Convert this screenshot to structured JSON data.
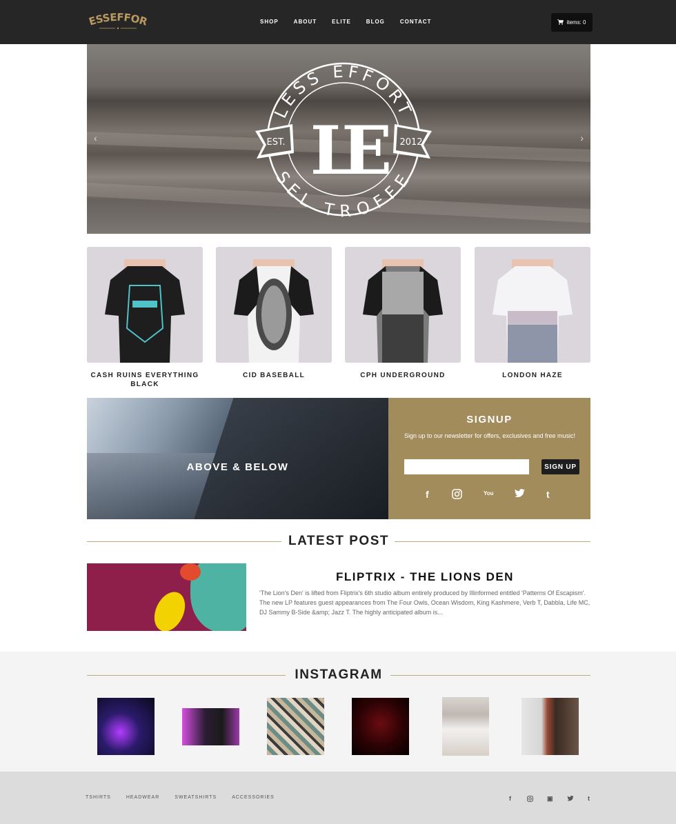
{
  "header": {
    "logo_text": "LESSEFFORT",
    "nav": [
      "SHOP",
      "ABOUT",
      "ELITE",
      "BLOG",
      "CONTACT"
    ],
    "cart_label": "items: 0"
  },
  "hero": {
    "emblem_top_text": "LESS EFFORT",
    "emblem_bottom_text": "SEL TROFFE",
    "emblem_monogram": "LE",
    "emblem_left_ribbon": "EST.",
    "emblem_right_ribbon": "2012",
    "prev_arrow": "‹",
    "next_arrow": "›"
  },
  "products": [
    {
      "name": "CASH RUINS EVERYTHING BLACK"
    },
    {
      "name": "CID BASEBALL"
    },
    {
      "name": "CPH UNDERGROUND"
    },
    {
      "name": "LONDON HAZE"
    }
  ],
  "promo": {
    "title": "ABOVE & BELOW"
  },
  "signup": {
    "title": "SIGNUP",
    "text": "Sign up to our newsletter for offers, exclusives and free music!",
    "input_value": "",
    "button_label": "SIGN UP",
    "socials": [
      "f",
      "◎",
      "You",
      "🐦",
      "t"
    ]
  },
  "latest_post": {
    "heading": "LATEST POST",
    "title": "FLIPTRIX - THE LIONS DEN",
    "excerpt": "'The Lion's Den' is lifted from Fliptrix's 6th studio album entirely produced by Illinformed entitled 'Patterns Of Escapism'. The new LP features guest appearances from The Four Owls, Ocean Wisdom, King Kashmere, Verb T, Dabbla, Life MC, DJ Sammy B-Side &amp; Jazz T. The highly anticipated album is..."
  },
  "instagram": {
    "heading": "INSTAGRAM"
  },
  "footer": {
    "links": [
      "TSHIRTS",
      "HEADWEAR",
      "SWEATSHIRTS",
      "ACCESSORIES"
    ],
    "socials": [
      "f",
      "◎",
      "▣",
      "🐦",
      "t"
    ]
  }
}
